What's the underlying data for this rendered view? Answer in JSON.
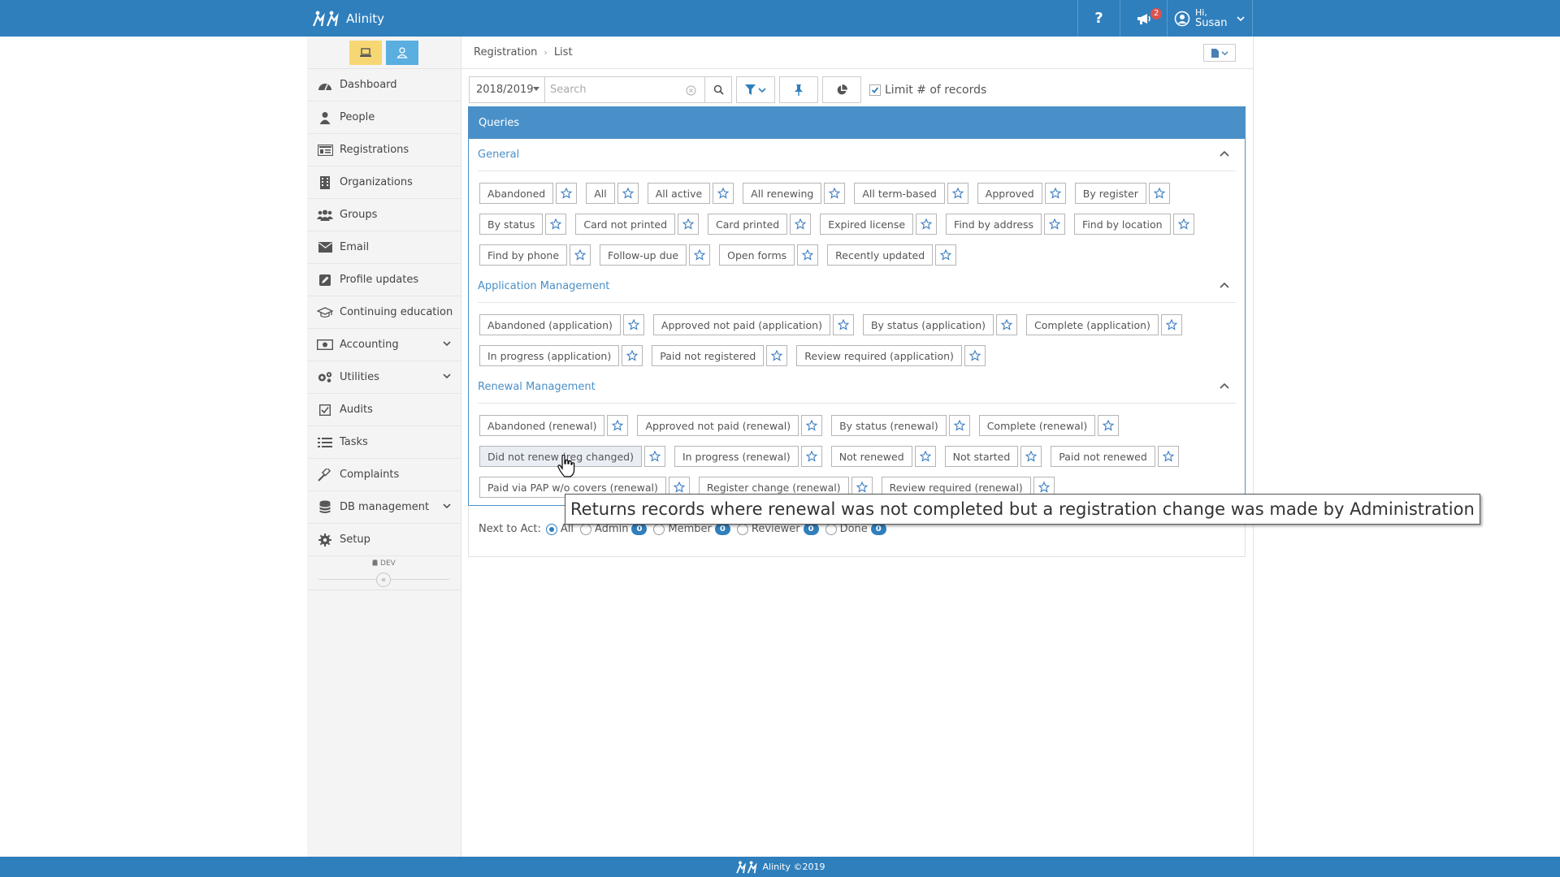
{
  "app": {
    "brand": "Alinity",
    "help_label": "?",
    "notification_count": "2",
    "user_greeting": "Hi,",
    "user_name": "Susan"
  },
  "colors": {
    "primary": "#2f7fbd",
    "panel_header": "#4a90c8",
    "section_text": "#4a8fc7",
    "switch_yellow": "#f7d774",
    "switch_blue": "#5aaee0",
    "badge_red": "#d9534f"
  },
  "sidebar": {
    "items": [
      {
        "label": "Dashboard",
        "icon": "dashboard-icon"
      },
      {
        "label": "People",
        "icon": "person-icon"
      },
      {
        "label": "Registrations",
        "icon": "id-card-icon"
      },
      {
        "label": "Organizations",
        "icon": "building-icon"
      },
      {
        "label": "Groups",
        "icon": "users-icon"
      },
      {
        "label": "Email",
        "icon": "envelope-icon"
      },
      {
        "label": "Profile updates",
        "icon": "edit-icon"
      },
      {
        "label": "Continuing education",
        "icon": "graduation-cap-icon"
      },
      {
        "label": "Accounting",
        "icon": "money-icon",
        "expandable": true
      },
      {
        "label": "Utilities",
        "icon": "cogs-icon",
        "expandable": true
      },
      {
        "label": "Audits",
        "icon": "checkbox-icon"
      },
      {
        "label": "Tasks",
        "icon": "list-icon"
      },
      {
        "label": "Complaints",
        "icon": "gavel-icon"
      },
      {
        "label": "DB management",
        "icon": "database-icon",
        "expandable": true
      },
      {
        "label": "Setup",
        "icon": "gear-icon"
      }
    ],
    "env_tag": "DEV",
    "collapse_label": "«"
  },
  "breadcrumb": {
    "items": [
      "Registration",
      "List"
    ]
  },
  "toolbar": {
    "year": "2018/2019",
    "search_placeholder": "Search",
    "limit_label": "Limit # of records",
    "limit_checked": true
  },
  "queries": {
    "title": "Queries",
    "sections": [
      {
        "title": "General",
        "rows": [
          [
            "Abandoned",
            "All",
            "All active",
            "All renewing",
            "All term-based",
            "Approved",
            "By register"
          ],
          [
            "By status",
            "Card not printed",
            "Card printed",
            "Expired license",
            "Find by address",
            "Find by location"
          ],
          [
            "Find by phone",
            "Follow-up due",
            "Open forms",
            "Recently updated"
          ]
        ]
      },
      {
        "title": "Application Management",
        "rows": [
          [
            "Abandoned (application)",
            "Approved not paid (application)",
            "By status (application)",
            "Complete (application)"
          ],
          [
            "In progress (application)",
            "Paid not registered",
            "Review required (application)"
          ]
        ]
      },
      {
        "title": "Renewal Management",
        "rows": [
          [
            "Abandoned (renewal)",
            "Approved not paid (renewal)",
            "By status (renewal)",
            "Complete (renewal)"
          ],
          [
            "Did not renew (reg changed)",
            "In progress (renewal)",
            "Not renewed",
            "Not started",
            "Paid not renewed"
          ],
          [
            "Paid via PAP w/o covers (renewal)",
            "Register change (renewal)",
            "Review required (renewal)"
          ]
        ]
      }
    ],
    "hovered": "Did not renew (reg changed)"
  },
  "next_to_act": {
    "label": "Next to Act:",
    "options": [
      {
        "label": "All",
        "selected": true
      },
      {
        "label": "Admin",
        "count": "0"
      },
      {
        "label": "Member",
        "count": "0"
      },
      {
        "label": "Reviewer",
        "count": "0"
      },
      {
        "label": "Done",
        "count": "0"
      }
    ]
  },
  "tooltip": {
    "text": "Returns records where renewal was not completed but a registration change was made by Administration"
  },
  "footer": {
    "text": "Alinity ©2019"
  }
}
